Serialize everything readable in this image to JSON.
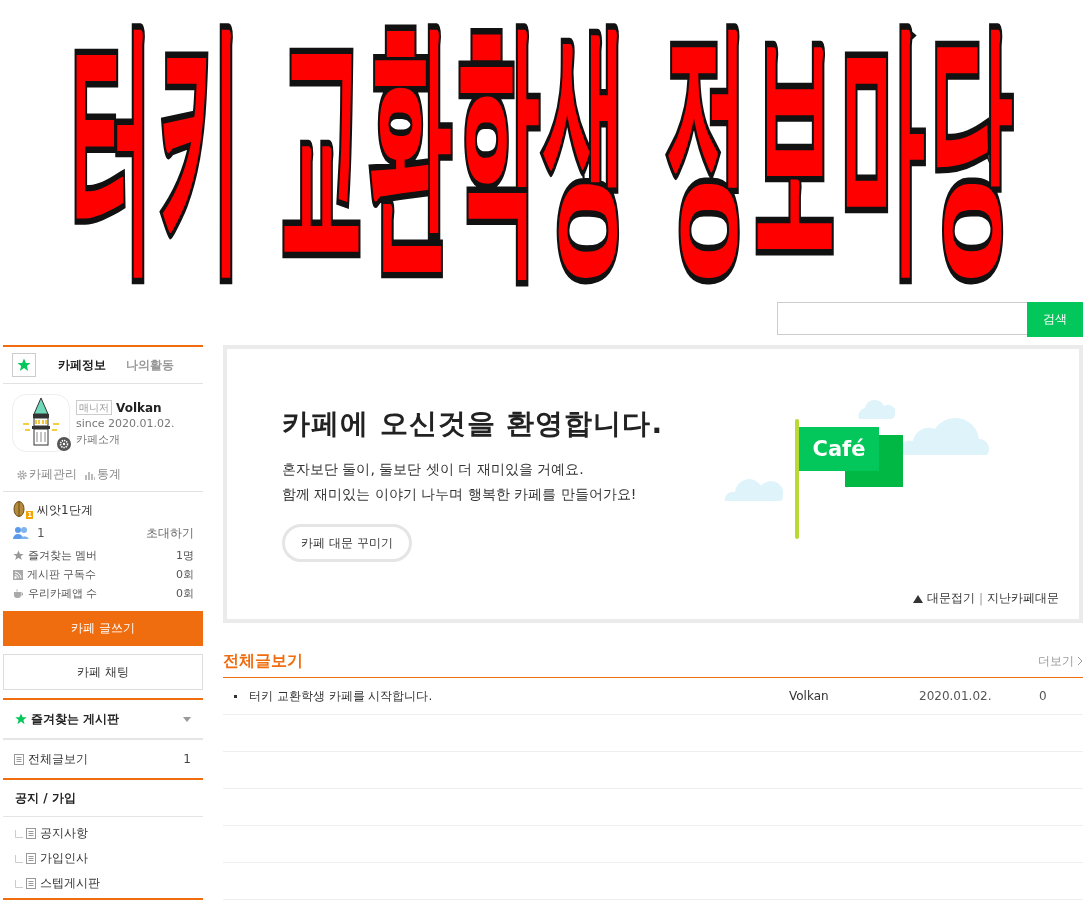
{
  "banner_title": "터키 교환학생 정보마당",
  "search": {
    "button": "검색"
  },
  "sidebar": {
    "tabs": [
      {
        "label": "카페정보",
        "selected": true
      },
      {
        "label": "나의활동",
        "selected": false
      }
    ],
    "profile": {
      "badge": "매니저",
      "name": "Volkan",
      "since": "since 2020.01.02.",
      "intro": "카페소개"
    },
    "admin_links": [
      {
        "kind": "gear",
        "label": "카페관리"
      },
      {
        "kind": "chart",
        "label": "통계"
      }
    ],
    "level": "씨앗1단계",
    "level_badge": "1",
    "members": "1",
    "invite": "초대하기",
    "stats": [
      {
        "kind": "star",
        "label": "즐겨찾는 멤버",
        "value": "1명"
      },
      {
        "kind": "rss",
        "label": "게시판 구독수",
        "value": "0회"
      },
      {
        "kind": "cup",
        "label": "우리카페앱 수",
        "value": "0회"
      }
    ],
    "write_button": "카페 글쓰기",
    "chat_button": "카페 채팅",
    "favorites": {
      "title": "즐겨찾는 게시판",
      "expanded": false
    },
    "all_posts": {
      "label": "전체글보기",
      "count": "1"
    },
    "groups": [
      {
        "title": "공지 / 가입",
        "boards": [
          "공지사항",
          "가입인사",
          "스텝게시판"
        ]
      }
    ]
  },
  "welcome": {
    "title": "카페에 오신것을 환영합니다.",
    "lines": [
      "혼자보단 둘이, 둘보단 셋이 더 재미있을 거예요.",
      "함께 재미있는 이야기 나누며 행복한 카페를 만들어가요!"
    ],
    "button": "카페 대문 꾸미기",
    "flag_text": "Café",
    "links": [
      "대문접기",
      "지난카페대문"
    ],
    "separator": "|"
  },
  "posts": {
    "title": "전체글보기",
    "more": "더보기",
    "rows": [
      {
        "title": "터키 교환학생 카페를 시작합니다.",
        "author": "Volkan",
        "date": "2020.01.02.",
        "views": "0"
      }
    ]
  }
}
